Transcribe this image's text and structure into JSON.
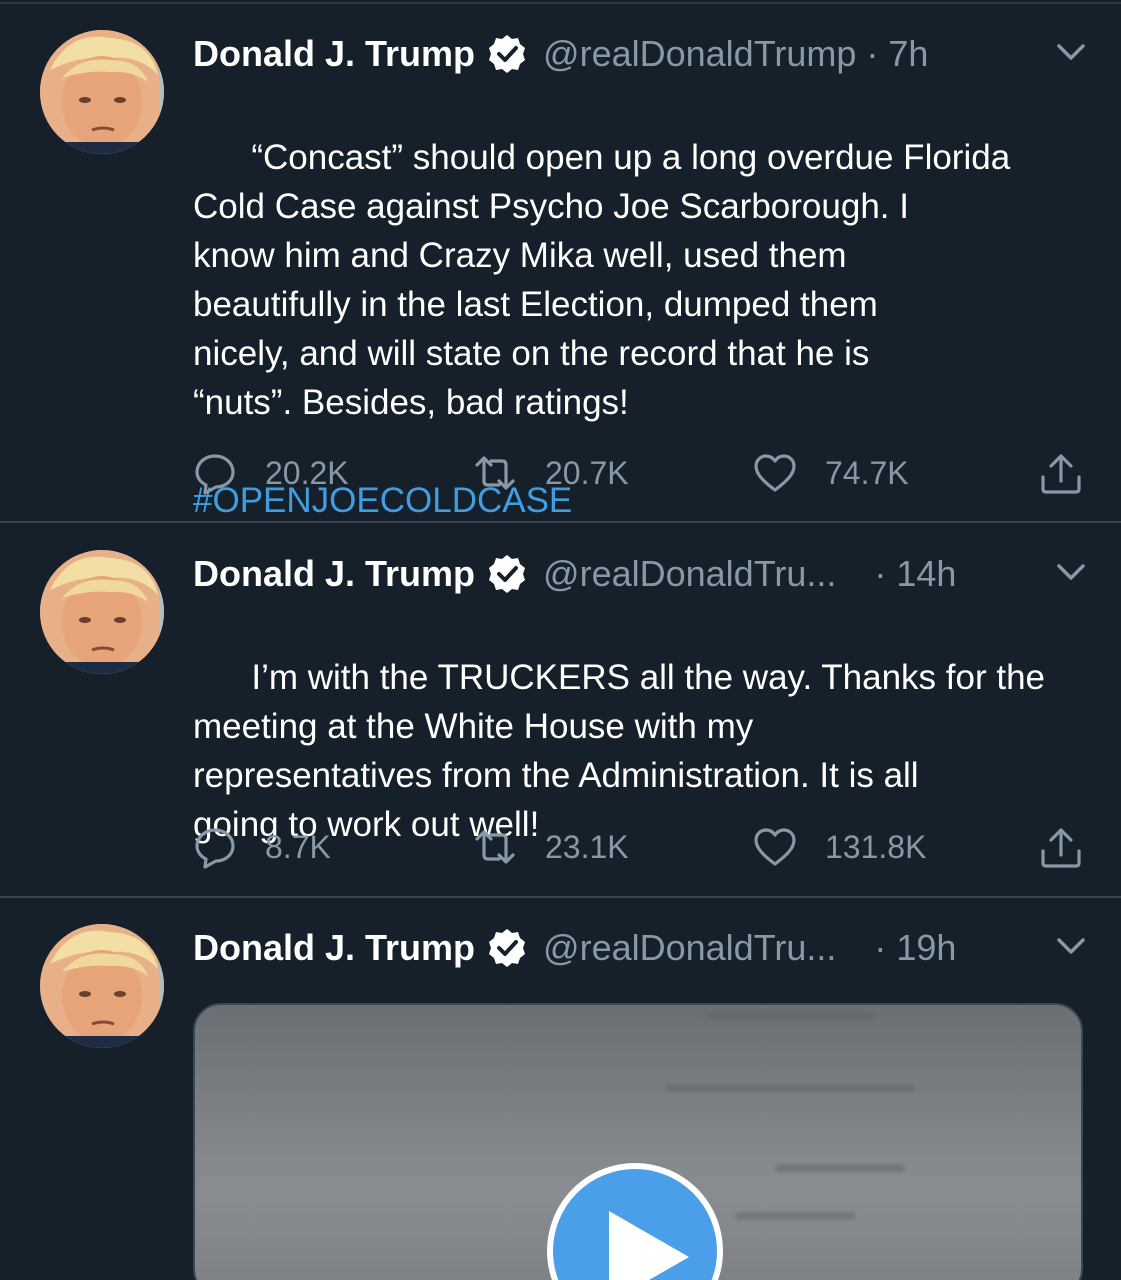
{
  "colors": {
    "background": "#15202b",
    "secondary_text": "#8899a6",
    "hashtag": "#3f9ee0",
    "play_button": "#4a9fe8",
    "divider": "#38444d"
  },
  "tweets": [
    {
      "name": "Donald J. Trump",
      "handle": "@realDonaldTrump",
      "dot": "·",
      "time": "7h",
      "text": "“Concast” should open up a long overdue Florida\nCold Case against Psycho Joe Scarborough. I\nknow him and Crazy Mika well, used them\nbeautifully in the last Election, dumped them\nnicely, and will state on the record that he is\n“nuts”. Besides, bad ratings!",
      "hashtag": "#OPENJOECOLDCASE",
      "replies": "20.2K",
      "retweets": "20.7K",
      "likes": "74.7K"
    },
    {
      "name": "Donald J. Trump",
      "handle": "@realDonaldTru...",
      "dot": "·",
      "time": "14h",
      "text": "I’m with the TRUCKERS all the way. Thanks for the\nmeeting at the White House with my\nrepresentatives from the Administration. It is all\ngoing to work out well!",
      "replies": "8.7K",
      "retweets": "23.1K",
      "likes": "131.8K"
    },
    {
      "name": "Donald J. Trump",
      "handle": "@realDonaldTru...",
      "dot": "·",
      "time": "19h"
    }
  ],
  "icons": {
    "verified": "verified-badge-icon",
    "caret": "chevron-down-icon",
    "reply": "reply-bubble-icon",
    "retweet": "retweet-icon",
    "like": "heart-icon",
    "share": "share-upload-icon",
    "play": "play-icon"
  }
}
